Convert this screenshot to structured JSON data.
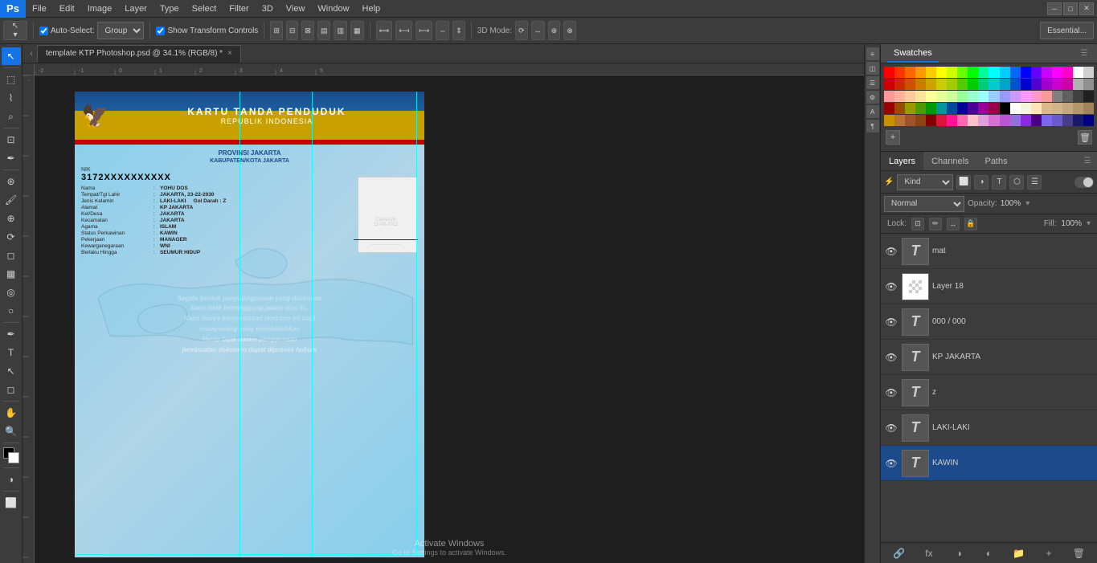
{
  "app": {
    "logo": "Ps",
    "title": "template KTP Photoshop.psd @ 34.1% (RGB/8) *"
  },
  "menu": {
    "items": [
      "File",
      "Edit",
      "Image",
      "Layer",
      "Type",
      "Select",
      "Filter",
      "3D",
      "View",
      "Window",
      "Help"
    ]
  },
  "toolbar": {
    "auto_select_label": "Auto-Select:",
    "group_label": "Group",
    "show_transform_label": "Show Transform Controls",
    "mode_3d_label": "3D Mode:",
    "essential_label": "Essential..."
  },
  "tabs": {
    "active_tab": "template KTP Photoshop.psd @ 34.1% (RGB/8) *",
    "close_symbol": "×"
  },
  "ktp": {
    "main_title": "KARTU TANDA PENDUDUK",
    "sub_title": "REPUBLIK INDONESIA",
    "province": "PROVINSI JAKARTA",
    "city": "KABUPATEN/KOTA JAKARTA",
    "nik_label": "NIK",
    "nik": "3172XXXXXXXXXX",
    "fields": [
      {
        "label": "Nama",
        "value": "YOHU DOS"
      },
      {
        "label": "Tempat/Tgl Lahir",
        "value": "JAKARTA, 23-22-2030"
      },
      {
        "label": "Jenis Kelamin",
        "value": "LAKI-LAKI       Gol Darah : Z"
      },
      {
        "label": "Alamat",
        "value": "KP JAKARTA"
      },
      {
        "label": "Kel/Desa",
        "value": "JAKARTA"
      },
      {
        "label": "Kecamatan",
        "value": "JAKARTA"
      },
      {
        "label": "Agama",
        "value": "ISLAM"
      },
      {
        "label": "Status Perkawinan",
        "value": "KAWIN"
      },
      {
        "label": "Pekerjaan",
        "value": "MANAGER"
      },
      {
        "label": "Kewarganegaraan",
        "value": "WNI"
      },
      {
        "label": "Berlaku Hingga",
        "value": "SEUMUR HIDUP"
      }
    ],
    "sig_city": "CIANJUR",
    "sig_date": "12-08-2012",
    "watermark_lines": [
      "Segala bentuk penyalahgunaan yang dilakukan",
      "kami tidak bertanggung jawab atas itu.",
      "Kami hanya menyediakan template ini bagi",
      "orang-orang yang membutuhkan",
      "Harap bijak dalam penggunaan",
      "pembuatan dokumen dapat diproses hukum"
    ]
  },
  "swatches": {
    "panel_label": "Swatches",
    "colors": [
      [
        "#ff0000",
        "#ff3300",
        "#ff6600",
        "#ff9900",
        "#ffcc00",
        "#ffff00",
        "#ccff00",
        "#99ff00",
        "#66ff00",
        "#33ff00",
        "#00ff00",
        "#00ff33",
        "#00ff66",
        "#00ff99",
        "#00ffcc",
        "#00ffff",
        "#00ccff",
        "#0099ff",
        "#0066ff",
        "#0033ff",
        "#0000ff",
        "#3300ff",
        "#6600ff",
        "#9900ff",
        "#cc00ff",
        "#ff00ff",
        "#ff00cc",
        "#ff0099",
        "#ff0066",
        "#ff0033"
      ],
      [
        "#cc0000",
        "#cc2900",
        "#cc5200",
        "#cc7a00",
        "#cca300",
        "#cccc00",
        "#a3cc00",
        "#7acc00",
        "#52cc00",
        "#29cc00",
        "#00cc00",
        "#00cc29",
        "#00cc52",
        "#00cc7a",
        "#00cca3",
        "#00cccc",
        "#00a3cc",
        "#007acc",
        "#0052cc",
        "#0029cc",
        "#0000cc",
        "#2900cc",
        "#5200cc",
        "#7a00cc",
        "#a300cc",
        "#cc00cc",
        "#cc00a3",
        "#cc007a",
        "#cc0052",
        "#cc0029"
      ],
      [
        "#ff6666",
        "#ff8c66",
        "#ffb266",
        "#ffd966",
        "#ffff66",
        "#d9ff66",
        "#b2ff66",
        "#8cff66",
        "#66ff66",
        "#66ff8c",
        "#66ffb2",
        "#66ffd9",
        "#66ffff",
        "#66d9ff",
        "#66b2ff",
        "#668cff",
        "#6666ff",
        "#8c66ff",
        "#b266ff",
        "#d966ff",
        "#ff66ff",
        "#ff66d9",
        "#ff66b2",
        "#ff668c",
        "#ffffff",
        "#e0e0e0",
        "#c0c0c0",
        "#a0a0a0",
        "#808080",
        "#606060"
      ],
      [
        "#400000",
        "#402900",
        "#405200",
        "#407a00",
        "#408000",
        "#004040",
        "#003040",
        "#002040",
        "#001040",
        "#000040",
        "#200040",
        "#400040",
        "#400030",
        "#400020",
        "#400010",
        "#333333",
        "#1a1a1a",
        "#000000",
        "#f5f5f5",
        "#ebebeb",
        "#d4d4d4",
        "#bdbdbd",
        "#a6a6a6",
        "#8f8f8f",
        "#787878",
        "#616161",
        "#4a4a4a",
        "#333333",
        "#1c1c1c",
        "#050505"
      ],
      [
        "#ff9966",
        "#ffcc99",
        "#ffe0b3",
        "#ffd4aa",
        "#c8960c",
        "#b87333",
        "#cd7f32",
        "#a0522d",
        "#8b4513",
        "#6b3a2a",
        "#d2691e",
        "#8b4513",
        "#a52a2a",
        "#800000",
        "#8b0000",
        "#dc143c",
        "#ff1493",
        "#ff69b4",
        "#ffb6c1",
        "#ffc0cb",
        "#dda0dd",
        "#ee82ee",
        "#da70d6",
        "#ba55d3",
        "#9370db",
        "#8a2be2",
        "#4b0082",
        "#483d8b",
        "#6a5acd",
        "#7b68ee"
      ]
    ]
  },
  "layers_panel": {
    "tabs": [
      "Layers",
      "Channels",
      "Paths"
    ],
    "filter_label": "Kind",
    "blend_mode": "Normal",
    "opacity_label": "Opacity:",
    "opacity_value": "100%",
    "lock_label": "Lock:",
    "fill_label": "Fill:",
    "fill_value": "100%",
    "layers": [
      {
        "name": "mat",
        "type": "text",
        "visible": true,
        "active": false
      },
      {
        "name": "Layer 18",
        "type": "white",
        "visible": true,
        "active": false
      },
      {
        "name": "000 / 000",
        "type": "text",
        "visible": true,
        "active": false
      },
      {
        "name": "KP JAKARTA",
        "type": "text",
        "visible": true,
        "active": false
      },
      {
        "name": "z",
        "type": "text",
        "visible": true,
        "active": false
      },
      {
        "name": "LAKI-LAKI",
        "type": "text",
        "visible": true,
        "active": false
      },
      {
        "name": "KAWIN",
        "type": "text",
        "visible": true,
        "active": true
      }
    ]
  },
  "windows_activate": {
    "line1": "Activate Windows",
    "line2": "Go to Settings to activate Windows."
  }
}
